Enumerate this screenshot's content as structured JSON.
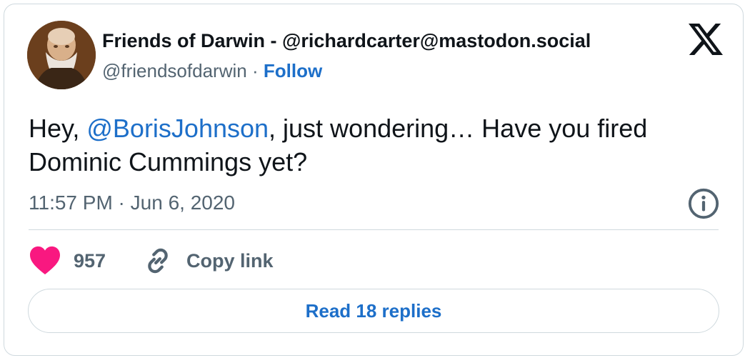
{
  "author": {
    "display_name": "Friends of Darwin - @richardcarter@mastodon.social",
    "handle": "@friendsofdarwin",
    "separator": "·",
    "follow_label": "Follow",
    "avatar_icon": "bearded-man-avatar"
  },
  "platform_icon": "x-logo-icon",
  "tweet": {
    "text_prefix": "Hey, ",
    "mention": "@BorisJohnson",
    "text_line1_suffix": ", just wondering… Have you fired",
    "text_line2": "Dominic Cummings yet?",
    "timestamp": "11:57 PM · Jun 6, 2020"
  },
  "actions": {
    "like_count": "957",
    "copy_link_label": "Copy link",
    "read_replies_label": "Read 18 replies"
  },
  "colors": {
    "link_blue": "#1d6fc9",
    "heart_pink": "#f91880",
    "secondary_text": "#536471",
    "border": "#cfd9de"
  }
}
